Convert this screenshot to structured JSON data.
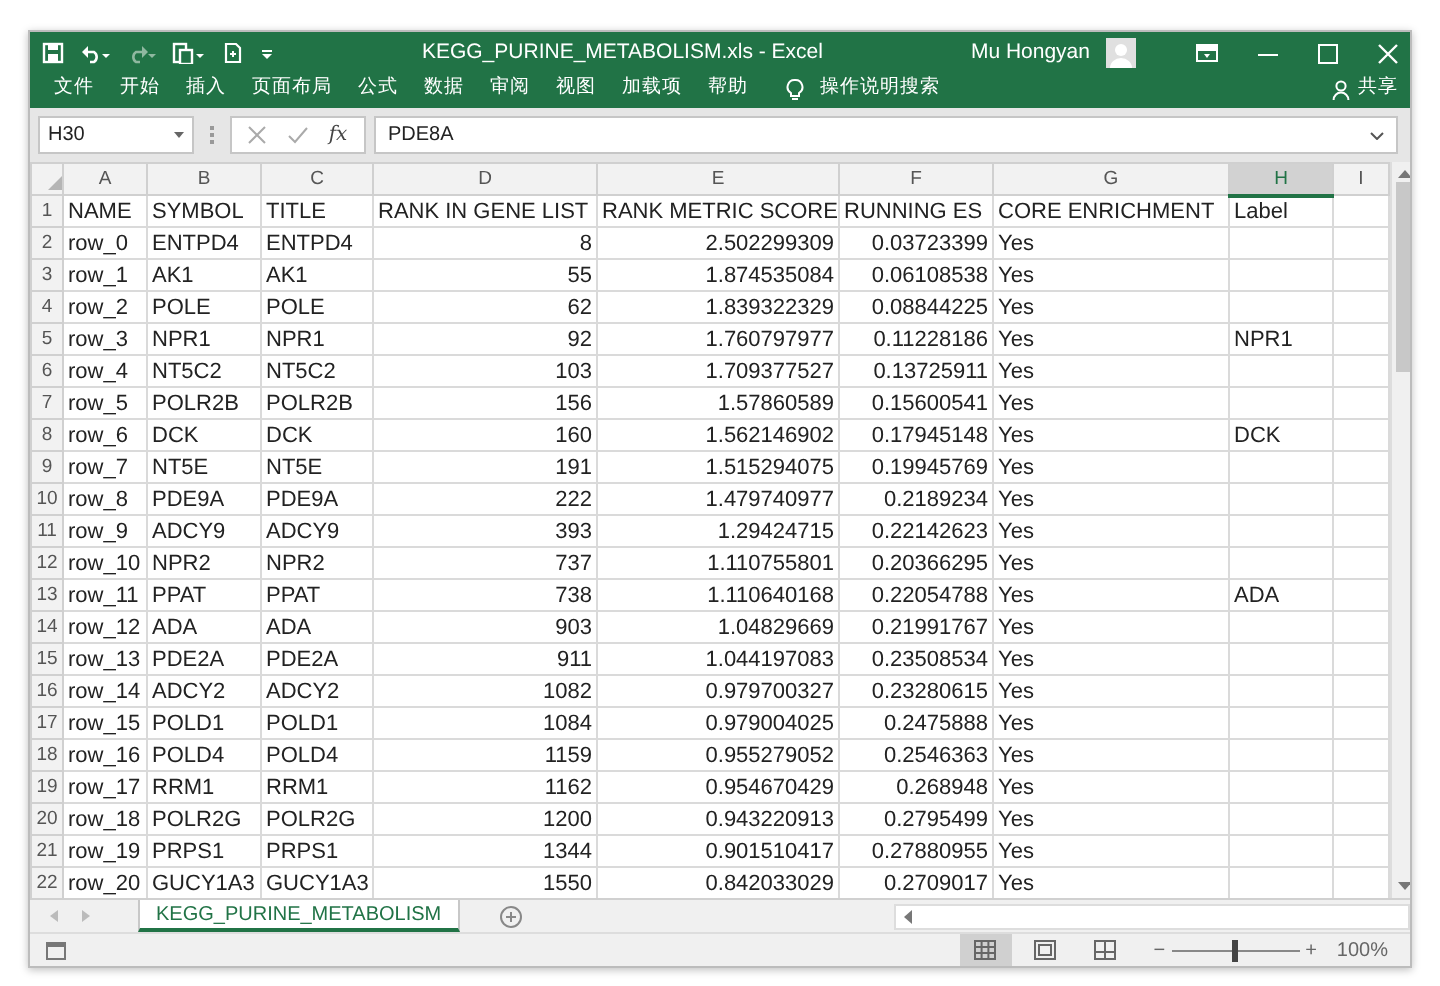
{
  "title_bar": {
    "title": "KEGG_PURINE_METABOLISM.xls - Excel",
    "user": "Mu Hongyan"
  },
  "ribbon_tabs": [
    "文件",
    "开始",
    "插入",
    "页面布局",
    "公式",
    "数据",
    "审阅",
    "视图",
    "加载项",
    "帮助"
  ],
  "tell_me": "操作说明搜索",
  "share": "共享",
  "formula_bar": {
    "name_box": "H30",
    "fx": "fx",
    "value": "PDE8A"
  },
  "columns": [
    {
      "letter": "A",
      "kind": "text",
      "selected": false
    },
    {
      "letter": "B",
      "kind": "text",
      "selected": false
    },
    {
      "letter": "C",
      "kind": "text",
      "selected": false
    },
    {
      "letter": "D",
      "kind": "number",
      "selected": false
    },
    {
      "letter": "E",
      "kind": "number",
      "selected": false
    },
    {
      "letter": "F",
      "kind": "number",
      "selected": false
    },
    {
      "letter": "G",
      "kind": "text",
      "selected": false
    },
    {
      "letter": "H",
      "kind": "text",
      "selected": true
    },
    {
      "letter": "I",
      "kind": "text",
      "selected": false
    }
  ],
  "rows": [
    {
      "number": "1",
      "cells": [
        "NAME",
        "SYMBOL",
        "TITLE",
        "RANK IN GENE LIST",
        "RANK METRIC SCORE",
        "RUNNING ES",
        "CORE ENRICHMENT",
        "Label"
      ]
    },
    {
      "number": "2",
      "cells": [
        "row_0",
        "ENTPD4",
        "ENTPD4",
        "8",
        "2.502299309",
        "0.03723399",
        "Yes"
      ]
    },
    {
      "number": "3",
      "cells": [
        "row_1",
        "AK1",
        "AK1",
        "55",
        "1.874535084",
        "0.06108538",
        "Yes"
      ]
    },
    {
      "number": "4",
      "cells": [
        "row_2",
        "POLE",
        "POLE",
        "62",
        "1.839322329",
        "0.08844225",
        "Yes"
      ]
    },
    {
      "number": "5",
      "cells": [
        "row_3",
        "NPR1",
        "NPR1",
        "92",
        "1.760797977",
        "0.11228186",
        "Yes",
        "NPR1"
      ]
    },
    {
      "number": "6",
      "cells": [
        "row_4",
        "NT5C2",
        "NT5C2",
        "103",
        "1.709377527",
        "0.13725911",
        "Yes"
      ]
    },
    {
      "number": "7",
      "cells": [
        "row_5",
        "POLR2B",
        "POLR2B",
        "156",
        "1.57860589",
        "0.15600541",
        "Yes"
      ]
    },
    {
      "number": "8",
      "cells": [
        "row_6",
        "DCK",
        "DCK",
        "160",
        "1.562146902",
        "0.17945148",
        "Yes",
        "DCK"
      ]
    },
    {
      "number": "9",
      "cells": [
        "row_7",
        "NT5E",
        "NT5E",
        "191",
        "1.515294075",
        "0.19945769",
        "Yes"
      ]
    },
    {
      "number": "10",
      "cells": [
        "row_8",
        "PDE9A",
        "PDE9A",
        "222",
        "1.479740977",
        "0.2189234",
        "Yes"
      ]
    },
    {
      "number": "11",
      "cells": [
        "row_9",
        "ADCY9",
        "ADCY9",
        "393",
        "1.29424715",
        "0.22142623",
        "Yes"
      ]
    },
    {
      "number": "12",
      "cells": [
        "row_10",
        "NPR2",
        "NPR2",
        "737",
        "1.110755801",
        "0.20366295",
        "Yes"
      ]
    },
    {
      "number": "13",
      "cells": [
        "row_11",
        "PPAT",
        "PPAT",
        "738",
        "1.110640168",
        "0.22054788",
        "Yes",
        "ADA"
      ]
    },
    {
      "number": "14",
      "cells": [
        "row_12",
        "ADA",
        "ADA",
        "903",
        "1.04829669",
        "0.21991767",
        "Yes"
      ]
    },
    {
      "number": "15",
      "cells": [
        "row_13",
        "PDE2A",
        "PDE2A",
        "911",
        "1.044197083",
        "0.23508534",
        "Yes"
      ]
    },
    {
      "number": "16",
      "cells": [
        "row_14",
        "ADCY2",
        "ADCY2",
        "1082",
        "0.979700327",
        "0.23280615",
        "Yes"
      ]
    },
    {
      "number": "17",
      "cells": [
        "row_15",
        "POLD1",
        "POLD1",
        "1084",
        "0.979004025",
        "0.2475888",
        "Yes"
      ]
    },
    {
      "number": "18",
      "cells": [
        "row_16",
        "POLD4",
        "POLD4",
        "1159",
        "0.955279052",
        "0.2546363",
        "Yes"
      ]
    },
    {
      "number": "19",
      "cells": [
        "row_17",
        "RRM1",
        "RRM1",
        "1162",
        "0.954670429",
        "0.268948",
        "Yes"
      ]
    },
    {
      "number": "20",
      "cells": [
        "row_18",
        "POLR2G",
        "POLR2G",
        "1200",
        "0.943220913",
        "0.2795499",
        "Yes"
      ]
    },
    {
      "number": "21",
      "cells": [
        "row_19",
        "PRPS1",
        "PRPS1",
        "1344",
        "0.901510417",
        "0.27880955",
        "Yes"
      ]
    },
    {
      "number": "22",
      "cells": [
        "row_20",
        "GUCY1A3",
        "GUCY1A3",
        "1550",
        "0.842033029",
        "0.2709017",
        "Yes"
      ]
    }
  ],
  "sheet_tabs": [
    {
      "label": "KEGG_PURINE_METABOLISM",
      "selected": true
    }
  ],
  "status_bar": {
    "views": [
      {
        "kind": "normal",
        "selected": true
      },
      {
        "kind": "page-layout",
        "selected": false
      },
      {
        "kind": "page-break",
        "selected": false
      }
    ],
    "zoom_out": "−",
    "zoom_in": "+",
    "zoom": {
      "level": 0.5,
      "reading": "100%"
    }
  }
}
